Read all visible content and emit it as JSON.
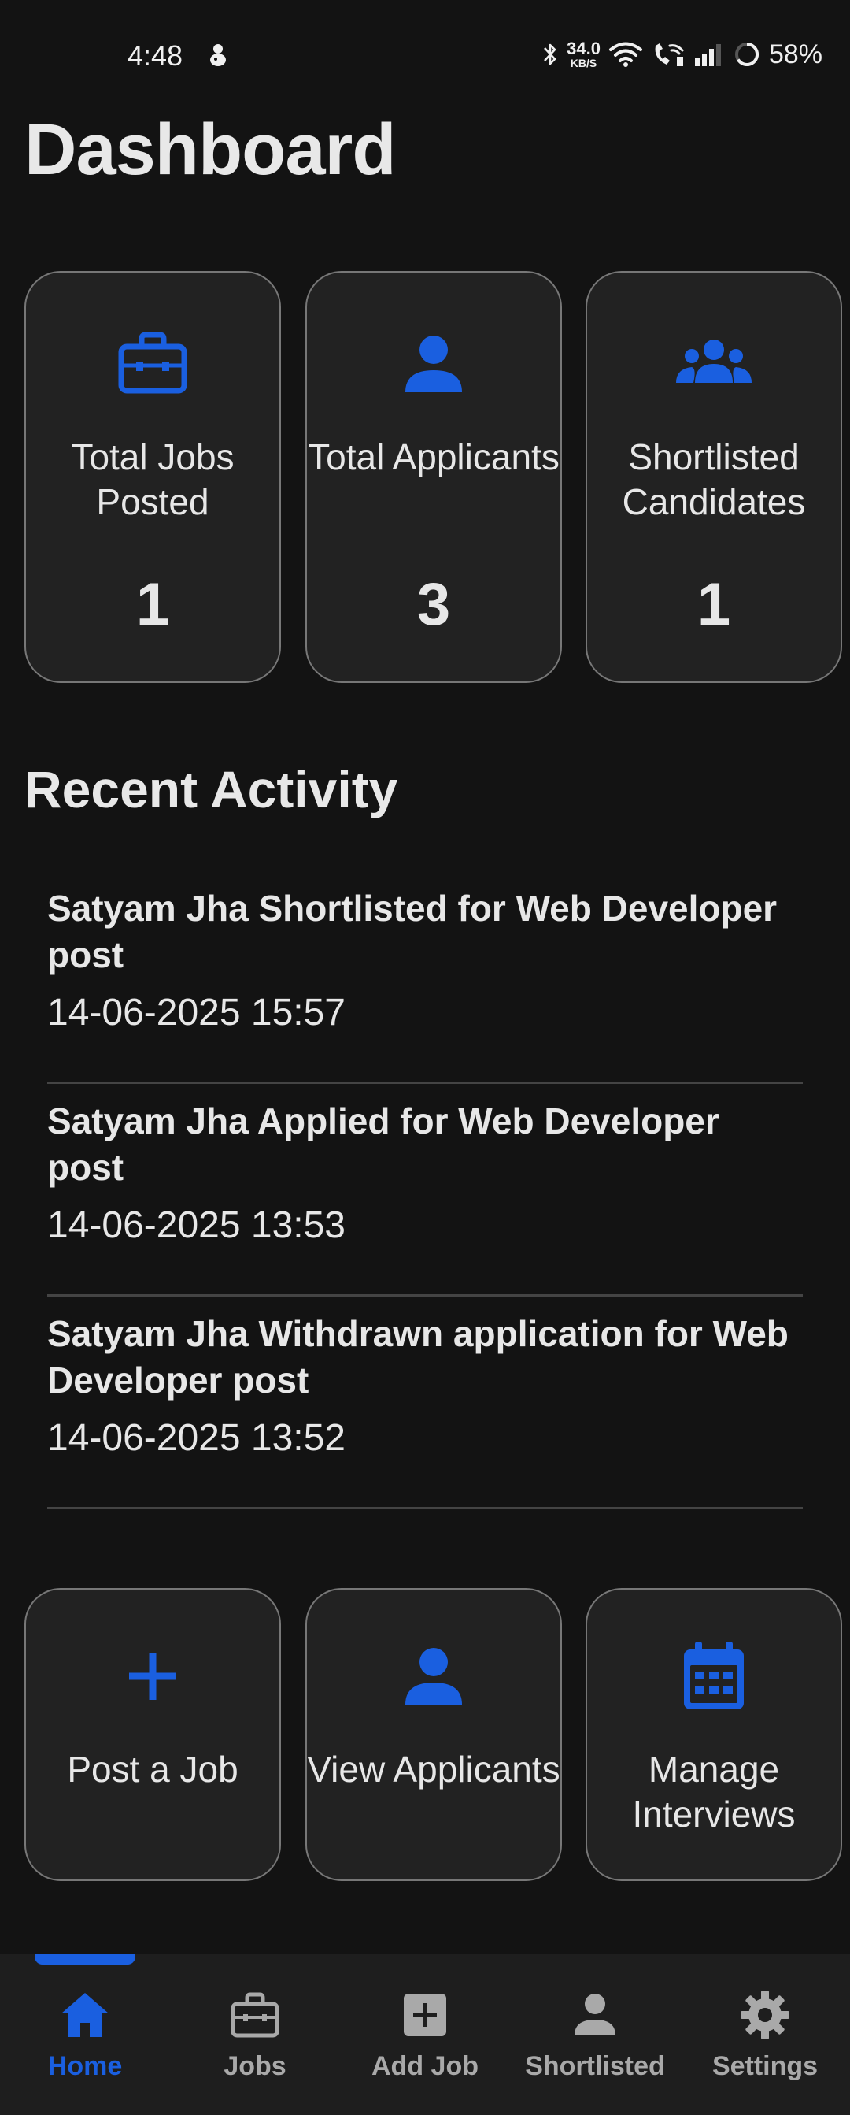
{
  "status_bar": {
    "time": "4:48",
    "net_speed_value": "34.0",
    "net_speed_unit": "KB/S",
    "battery": "58%"
  },
  "page": {
    "title": "Dashboard"
  },
  "stats": [
    {
      "label": "Total Jobs Posted",
      "value": "1",
      "icon": "briefcase-icon"
    },
    {
      "label": "Total Applicants",
      "value": "3",
      "icon": "person-icon"
    },
    {
      "label": "Shortlisted Candidates",
      "value": "1",
      "icon": "group-icon"
    }
  ],
  "recent_activity": {
    "title": "Recent Activity",
    "items": [
      {
        "text": "Satyam Jha Shortlisted for Web Developer post",
        "time": "14-06-2025 15:57"
      },
      {
        "text": "Satyam Jha Applied for Web Developer post",
        "time": "14-06-2025 13:53"
      },
      {
        "text": "Satyam Jha Withdrawn application for Web Developer post",
        "time": "14-06-2025 13:52"
      }
    ]
  },
  "actions": [
    {
      "label": "Post a Job",
      "icon": "plus-icon"
    },
    {
      "label": "View Applicants",
      "icon": "person-icon"
    },
    {
      "label": "Manage Interviews",
      "icon": "calendar-icon"
    }
  ],
  "bottom_nav": {
    "active": "Home",
    "items": [
      {
        "label": "Home",
        "icon": "home-icon"
      },
      {
        "label": "Jobs",
        "icon": "briefcase-icon"
      },
      {
        "label": "Add Job",
        "icon": "add-box-icon"
      },
      {
        "label": "Shortlisted",
        "icon": "person-icon"
      },
      {
        "label": "Settings",
        "icon": "gear-icon"
      }
    ]
  },
  "colors": {
    "accent": "#1a5fe0",
    "background": "#131313",
    "card_background": "#222222",
    "card_border": "#777777",
    "nav_background": "#1e1e1e",
    "nav_inactive": "#a9a9a9"
  }
}
